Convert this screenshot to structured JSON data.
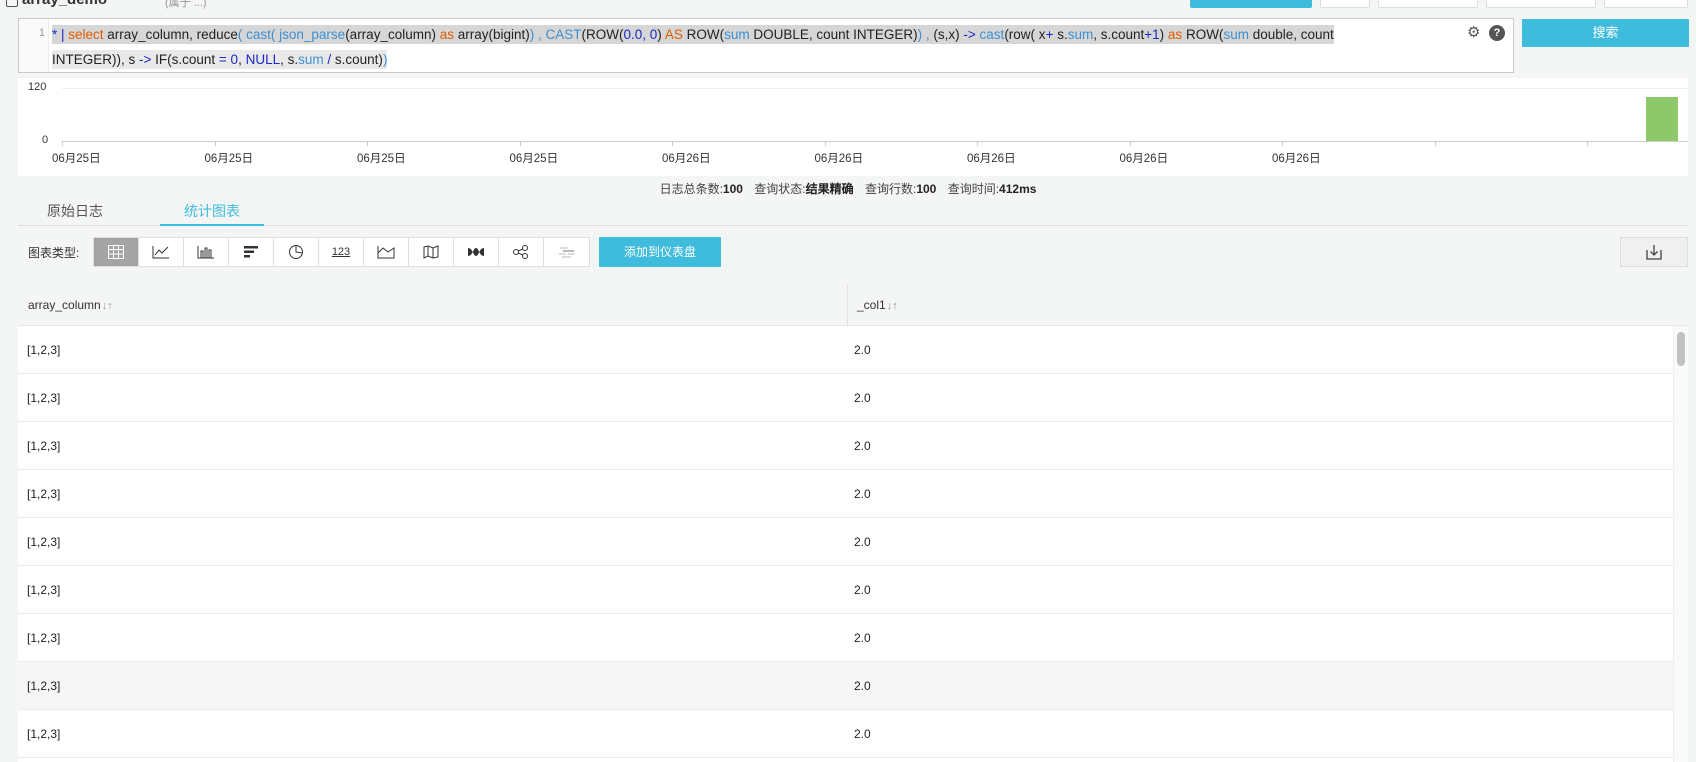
{
  "header": {
    "title": "array_demo",
    "subtitle": "(属于 ...)"
  },
  "editor": {
    "line_number": "1",
    "line1": [
      {
        "t": "* | ",
        "c": "op"
      },
      {
        "t": "select",
        "c": "kw"
      },
      {
        "t": "  array_column,  reduce",
        "c": ""
      },
      {
        "t": "( ",
        "c": "fn"
      },
      {
        "t": "cast",
        "c": "fn"
      },
      {
        "t": "(  ",
        "c": "fn"
      },
      {
        "t": "json_parse",
        "c": "fn"
      },
      {
        "t": "(array_column) ",
        "c": ""
      },
      {
        "t": "as",
        "c": "kw"
      },
      {
        "t": "  array(bigint)",
        "c": ""
      },
      {
        "t": ")  , ",
        "c": "fn"
      },
      {
        "t": "CAST",
        "c": "fn"
      },
      {
        "t": "(ROW(",
        "c": ""
      },
      {
        "t": "0.0, 0",
        "c": "num"
      },
      {
        "t": ") ",
        "c": ""
      },
      {
        "t": "AS",
        "c": "kw"
      },
      {
        "t": " ROW(",
        "c": ""
      },
      {
        "t": "sum",
        "c": "fn"
      },
      {
        "t": " DOUBLE, count INTEGER)",
        "c": ""
      },
      {
        "t": ")  ,  ",
        "c": "fn"
      },
      {
        "t": "(s,x) ",
        "c": ""
      },
      {
        "t": "->",
        "c": "op"
      },
      {
        "t": " ",
        "c": ""
      },
      {
        "t": "cast",
        "c": "fn"
      },
      {
        "t": "(row( x",
        "c": ""
      },
      {
        "t": "+",
        "c": "op"
      },
      {
        "t": " s.",
        "c": ""
      },
      {
        "t": "sum",
        "c": "fn"
      },
      {
        "t": ",  s.count",
        "c": ""
      },
      {
        "t": "+1",
        "c": "op"
      },
      {
        "t": ") ",
        "c": ""
      },
      {
        "t": "as",
        "c": "kw"
      },
      {
        "t": " ROW(",
        "c": ""
      },
      {
        "t": "sum",
        "c": "fn"
      },
      {
        "t": " double, count",
        "c": ""
      }
    ],
    "line2": [
      {
        "t": "INTEGER)), s ",
        "c": ""
      },
      {
        "t": "->",
        "c": "op"
      },
      {
        "t": " IF(s.count ",
        "c": ""
      },
      {
        "t": "= 0",
        "c": "op"
      },
      {
        "t": ", ",
        "c": ""
      },
      {
        "t": "NULL",
        "c": "op"
      },
      {
        "t": ", s.",
        "c": ""
      },
      {
        "t": "sum",
        "c": "fn"
      },
      {
        "t": " / ",
        "c": "op"
      },
      {
        "t": "s.count)",
        "c": ""
      },
      {
        "t": ")",
        "c": "fn"
      }
    ]
  },
  "search_button": "搜索",
  "histogram": {
    "y_ticks": [
      "120",
      "0"
    ],
    "x_labels": [
      "06月25日",
      "06月25日",
      "06月25日",
      "06月25日",
      "06月26日",
      "06月26日",
      "06月26日",
      "06月26日",
      "06月26日"
    ],
    "last_bucket_count": 100,
    "y_max": 120
  },
  "stats": {
    "total_label": "日志总条数:",
    "total_value": "100",
    "status_label": "查询状态:",
    "status_value": "结果精确",
    "rows_label": "查询行数:",
    "rows_value": "100",
    "time_label": "查询时间:",
    "time_value": "412ms"
  },
  "tabs": [
    {
      "label": "原始日志",
      "active": false
    },
    {
      "label": "统计图表",
      "active": true
    }
  ],
  "toolbar": {
    "chart_type_label": "图表类型:",
    "chart_types": [
      {
        "icon": "table-icon",
        "active": true
      },
      {
        "icon": "line-chart-icon",
        "active": false
      },
      {
        "icon": "column-chart-icon",
        "active": false
      },
      {
        "icon": "bar-chart-icon",
        "active": false
      },
      {
        "icon": "pie-chart-icon",
        "active": false
      },
      {
        "icon": "number-icon",
        "text": "123",
        "active": false
      },
      {
        "icon": "area-chart-icon",
        "active": false
      },
      {
        "icon": "map-icon",
        "active": false
      },
      {
        "icon": "flow-chart-icon",
        "active": false
      },
      {
        "icon": "sankey-icon",
        "active": false
      },
      {
        "icon": "word-cloud-icon",
        "active": false,
        "disabled": true
      }
    ],
    "add_dashboard_label": "添加到仪表盘"
  },
  "table": {
    "columns": [
      "array_column",
      "_col1"
    ],
    "rows": [
      [
        "[1,2,3]",
        "2.0"
      ],
      [
        "[1,2,3]",
        "2.0"
      ],
      [
        "[1,2,3]",
        "2.0"
      ],
      [
        "[1,2,3]",
        "2.0"
      ],
      [
        "[1,2,3]",
        "2.0"
      ],
      [
        "[1,2,3]",
        "2.0"
      ],
      [
        "[1,2,3]",
        "2.0"
      ],
      [
        "[1,2,3]",
        "2.0"
      ],
      [
        "[1,2,3]",
        "2.0"
      ]
    ],
    "hover_row_index": 7
  },
  "colors": {
    "accent": "#3fbcdc",
    "bar": "#8dc96b",
    "keyword": "#e05d00",
    "function": "#3d8fd1"
  }
}
